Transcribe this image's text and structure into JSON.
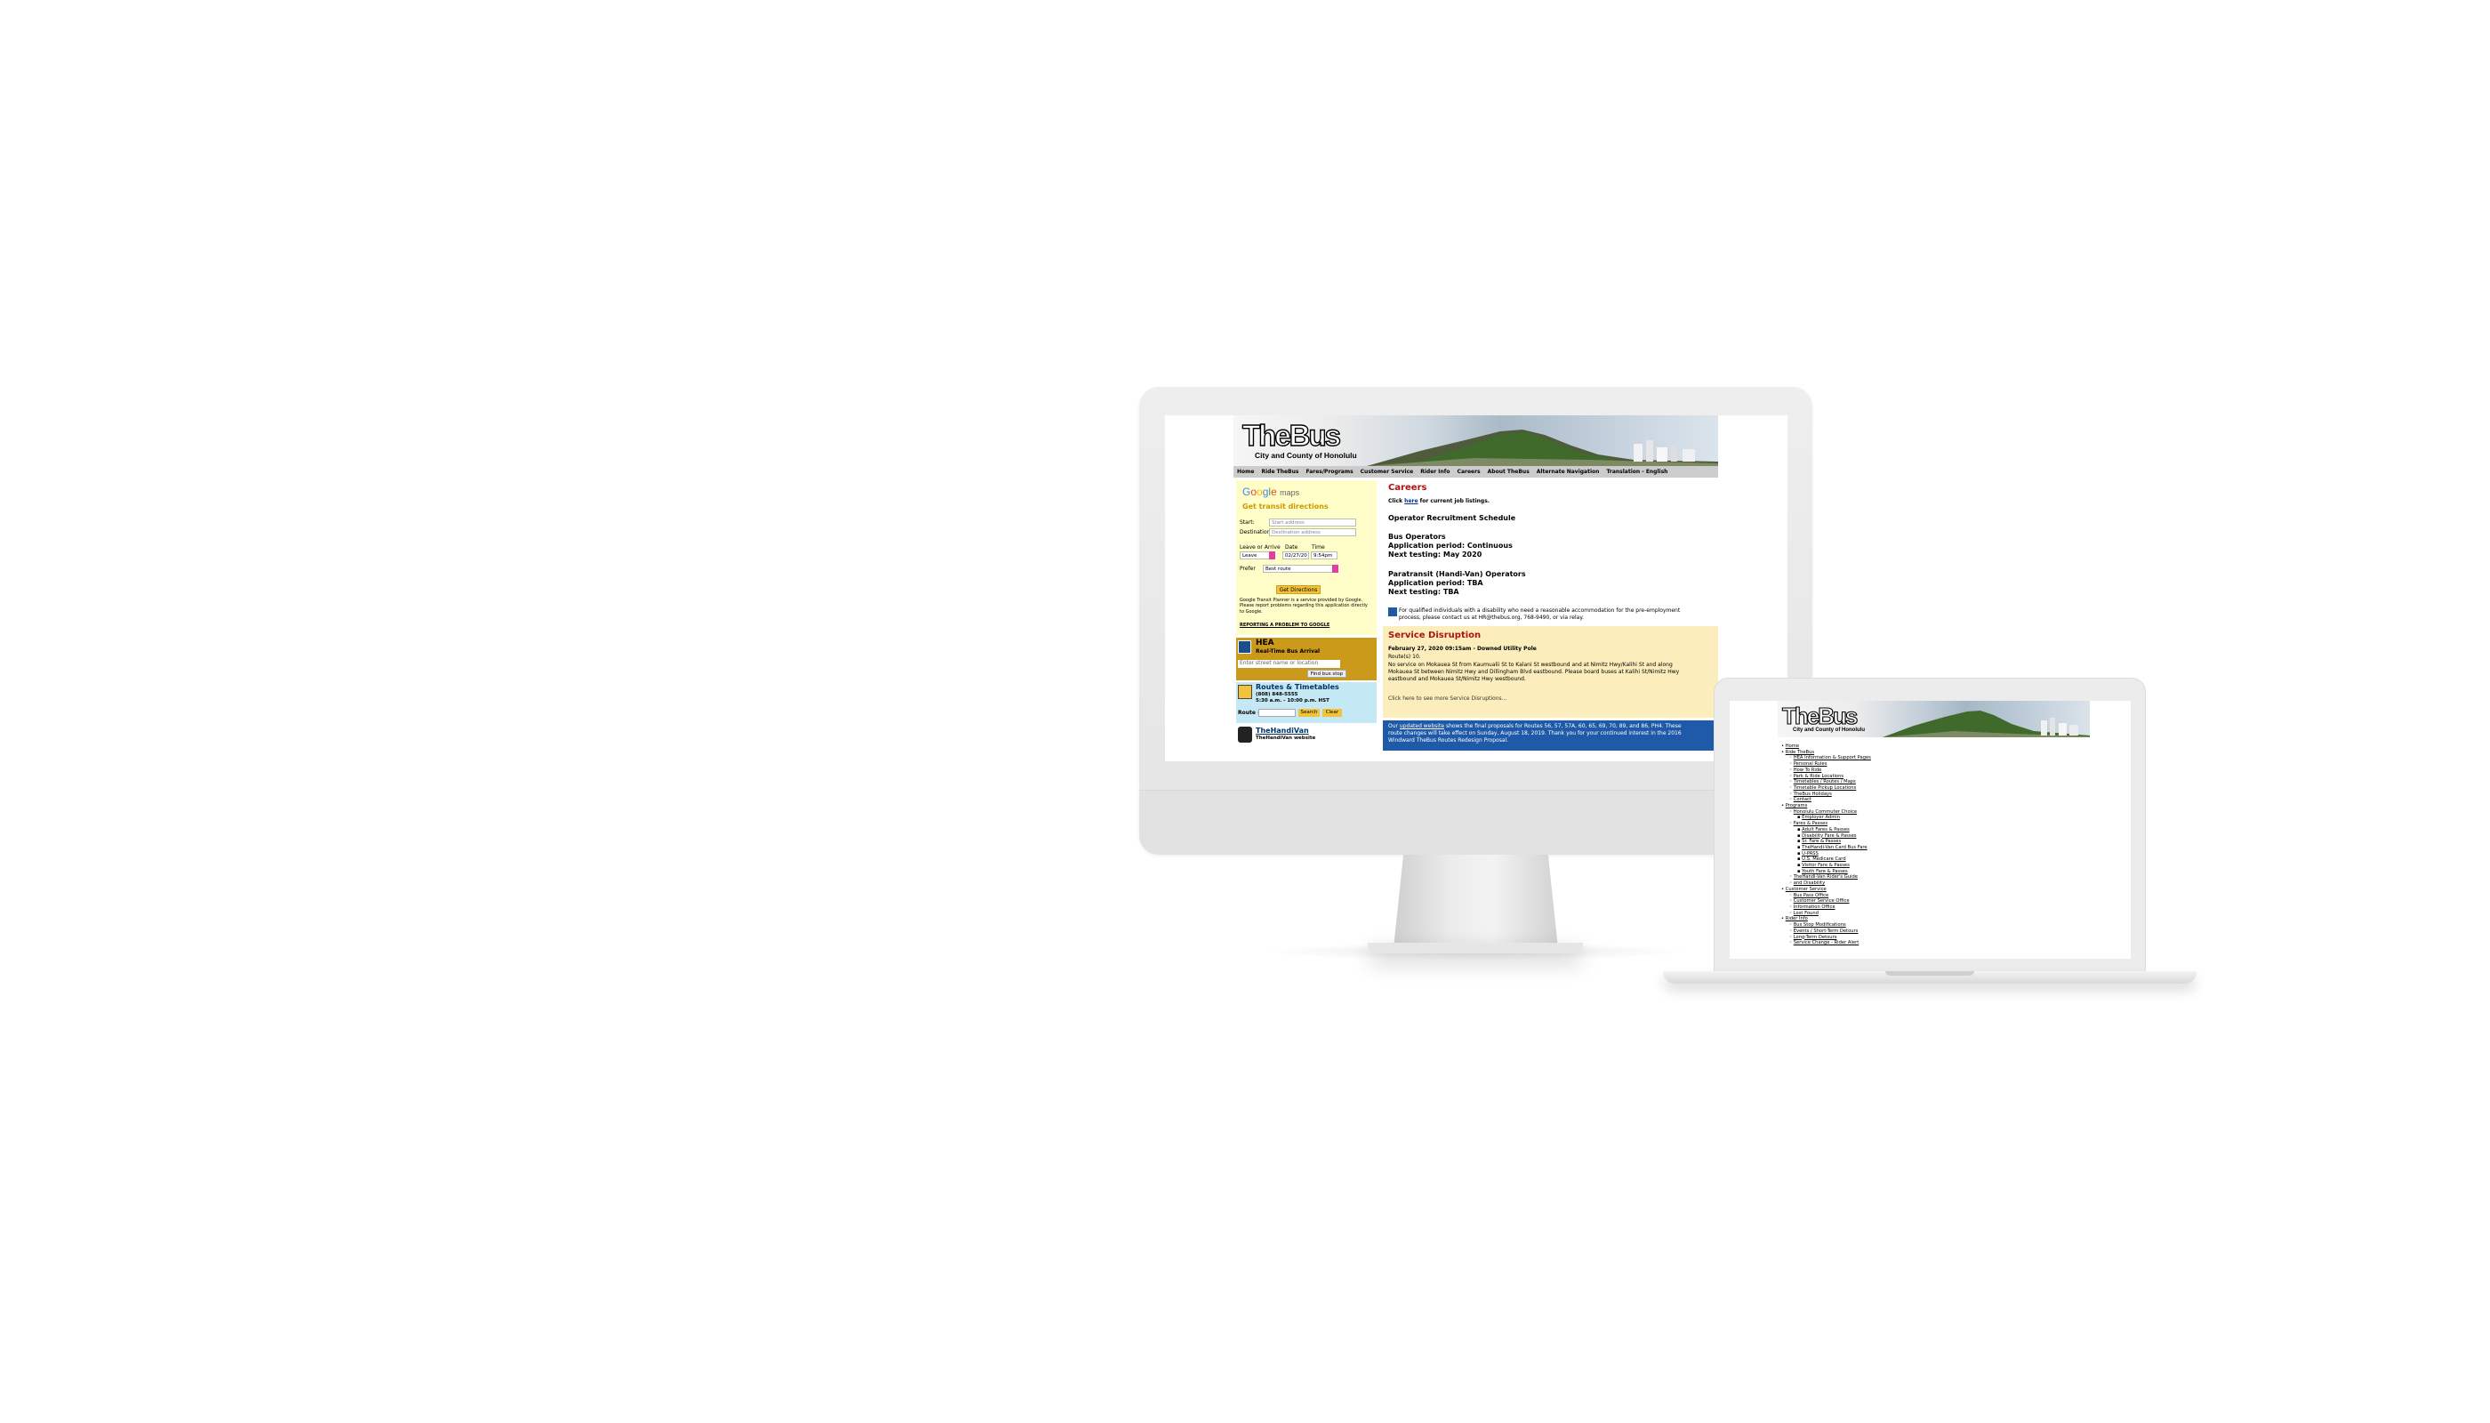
{
  "site": {
    "logo": "TheBus",
    "logo_sub": "City and County of Honolulu",
    "nav": [
      "Home",
      "Ride TheBus",
      "Fares/Programs",
      "Customer Service",
      "Rider Info",
      "Careers",
      "About TheBus",
      "Alternate Navigation",
      "Translation - English"
    ]
  },
  "gmaps": {
    "logo_maps": "maps",
    "title": "Get transit directions",
    "start_label": "Start:",
    "start_placeholder": "Start address",
    "dest_label": "Destination:",
    "dest_placeholder": "Destination address",
    "leave_label": "Leave or Arrive",
    "leave_value": "Leave",
    "date_label": "Date",
    "date_value": "02/27/20",
    "time_label": "Time",
    "time_value": "9:54pm",
    "prefer_label": "Prefer",
    "prefer_value": "Best route",
    "button": "Get Directions",
    "note": "Google Transit Planner is a service provided by Google. Please report problems regarding this application directly to Google.",
    "report_link": "REPORTING A PROBLEM TO GOOGLE"
  },
  "hea": {
    "title": "HEA",
    "subtitle": "Real-Time Bus Arrival",
    "input_placeholder": "Enter street name or location",
    "button": "Find bus stop"
  },
  "routes": {
    "title": "Routes & Timetables",
    "phone": "(808) 848-5555",
    "hours": "5:30 a.m. - 10:00 p.m. HST",
    "route_label": "Route #:",
    "search_btn": "Search",
    "clear_btn": "Clear"
  },
  "handivan": {
    "title": "TheHandiVan",
    "subtitle": "TheHandiVan website"
  },
  "careers": {
    "heading": "Careers",
    "click": "Click",
    "here": "here",
    "job_rest": "for current job listings.",
    "schedule": "Operator Recruitment Schedule",
    "bus_op": "Bus Operators",
    "bus_app": "Application period: Continuous",
    "bus_next": "Next testing: May 2020",
    "para_op": "Paratransit (Handi-Van) Operators",
    "para_app": "Application period: TBA",
    "para_next": "Next testing: TBA",
    "accommodation": "For qualified individuals with a disability who need a reasonable accommodation for the pre-employment process, please contact us at HR@thebus.org, 768-9490, or via relay."
  },
  "service": {
    "heading": "Service Disruption",
    "date": "February 27, 2020 09:15am - Downed Utility Pole",
    "routes": "Route(s) 10.",
    "body": "No service on Mokauea St from Kaumualii St to Kalani St westbound and at Nimitz Hwy/Kalihi St and along Mokauea St between Nimitz Hwy and Dillingham Blvd eastbound. Please board buses at Kalihi St/Nimitz Hwy eastbound and Mokauea St/Nimitz Hwy westbound.",
    "more": "Click here to see more Service Disruptions..."
  },
  "notice": {
    "our": "Our",
    "link": "updated website",
    "body": "shows the final proposals for Routes 56, 57, 57A, 60, 65, 69, 70, 89, and 86, PH4. These route changes will take effect on Sunday, August 18, 2019. Thank you for your continued interest in the 2016 Windward TheBus Routes Redesign Proposal."
  },
  "laptop": {
    "logo": "TheBus",
    "logo_sub": "City and County of Honolulu",
    "list": [
      {
        "level": 0,
        "text": "Home"
      },
      {
        "level": 0,
        "text": "Ride TheBus"
      },
      {
        "level": 1,
        "text": "HEA Information & Support Pages"
      },
      {
        "level": 1,
        "text": "Personal Rules"
      },
      {
        "level": 1,
        "text": "How To Ride"
      },
      {
        "level": 1,
        "text": "Park & Ride Locations"
      },
      {
        "level": 1,
        "text": "Timetables / Routes / Maps"
      },
      {
        "level": 1,
        "text": "Timetable Pickup Locations"
      },
      {
        "level": 1,
        "text": "TheBus Holidays"
      },
      {
        "level": 1,
        "text": "Contact"
      },
      {
        "level": 0,
        "text": "Programs"
      },
      {
        "level": 1,
        "text": "Honolulu Commuter Choice"
      },
      {
        "level": 2,
        "text": "Employer Admin"
      },
      {
        "level": 1,
        "text": "Fares & Passes"
      },
      {
        "level": 2,
        "text": "Adult Fares & Passes"
      },
      {
        "level": 2,
        "text": "Disability Fare & Passes"
      },
      {
        "level": 2,
        "text": "Sr. Fare & Passes"
      },
      {
        "level": 2,
        "text": "TheHandi-Van Card Bus Fare"
      },
      {
        "level": 2,
        "text": "U-PASS"
      },
      {
        "level": 2,
        "text": "U.S. Medicare Card"
      },
      {
        "level": 2,
        "text": "Visitor Fare & Passes"
      },
      {
        "level": 2,
        "text": "Youth Fare & Passes"
      },
      {
        "level": 1,
        "text": "TheHandi-Van Rider's Guide"
      },
      {
        "level": 1,
        "text": "and Disability"
      },
      {
        "level": 0,
        "text": "Customer Service"
      },
      {
        "level": 1,
        "text": "Bus Pass Office"
      },
      {
        "level": 1,
        "text": "Customer Service Office"
      },
      {
        "level": 1,
        "text": "Information Office"
      },
      {
        "level": 1,
        "text": "Lost Found"
      },
      {
        "level": 0,
        "text": "Rider Info"
      },
      {
        "level": 1,
        "text": "Bus Stop Modifications"
      },
      {
        "level": 1,
        "text": "Events / Short-Term Detours"
      },
      {
        "level": 1,
        "text": "Long-Term Detours"
      },
      {
        "level": 1,
        "text": "Service Change - Rider Alert"
      }
    ]
  }
}
